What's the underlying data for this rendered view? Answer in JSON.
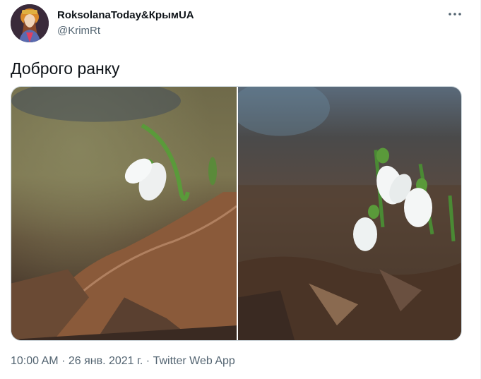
{
  "user": {
    "display_name": "RoksolanaToday&КрымUA",
    "handle": "@KrimRt"
  },
  "tweet": {
    "text": "Доброго ранку"
  },
  "meta": {
    "time": "10:00 AM",
    "separator": "·",
    "date": "26 янв. 2021 г.",
    "source": "Twitter Web App"
  },
  "icons": {
    "more": "more-horizontal-icon"
  },
  "colors": {
    "text": "#0f1419",
    "secondary": "#536471",
    "border": "#cfd9de"
  }
}
